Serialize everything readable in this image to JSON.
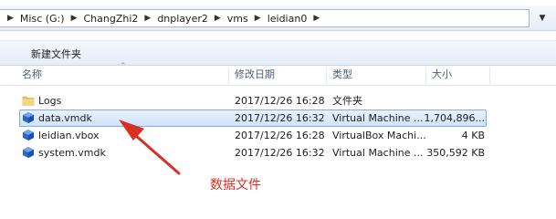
{
  "address": {
    "crumbs": [
      "Misc (G:)",
      "ChangZhi2",
      "dnplayer2",
      "vms",
      "leidian0"
    ]
  },
  "toolbar": {
    "new_folder_label": "新建文件夹"
  },
  "columns": {
    "name": "名称",
    "modified": "修改日期",
    "type": "类型",
    "size": "大小"
  },
  "files": [
    {
      "name": "Logs",
      "modified": "2017/12/26 16:28",
      "type": "文件夹",
      "size": "",
      "icon": "folder-icon"
    },
    {
      "name": "data.vmdk",
      "modified": "2017/12/26 16:32",
      "type": "Virtual Machine ...",
      "size": "1,704,896...",
      "icon": "vmdk-file-icon",
      "selected": true
    },
    {
      "name": "leidian.vbox",
      "modified": "2017/12/26 16:28",
      "type": "VirtualBox Machi...",
      "size": "4 KB",
      "icon": "vbox-file-icon"
    },
    {
      "name": "system.vmdk",
      "modified": "2017/12/26 16:32",
      "type": "Virtual Machine ...",
      "size": "350,592 KB",
      "icon": "vmdk-file-icon"
    }
  ],
  "annotation": {
    "text": "数据文件",
    "color": "#d93024"
  }
}
